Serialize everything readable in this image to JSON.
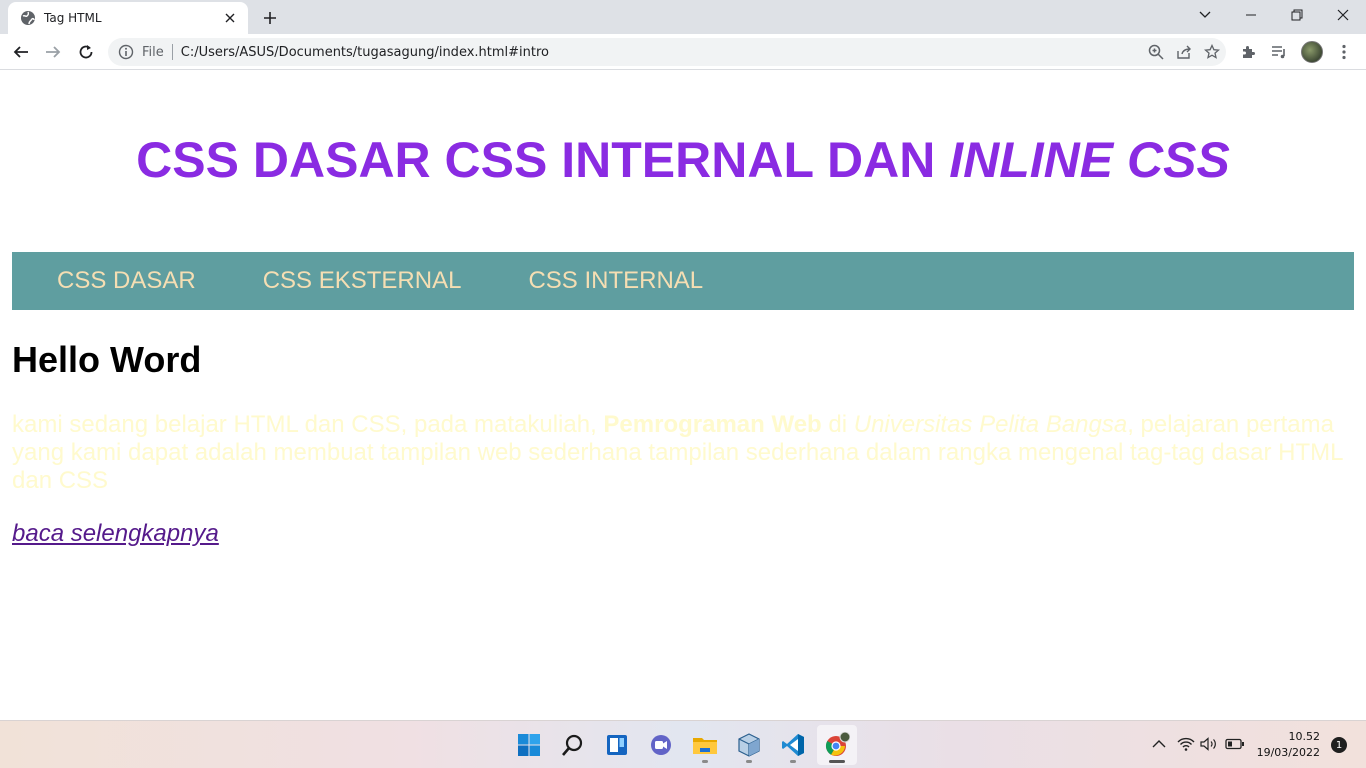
{
  "browser": {
    "tab_title": "Tag HTML",
    "omnibox_scheme_label": "File",
    "url": "C:/Users/ASUS/Documents/tugasagung/index.html#intro"
  },
  "page": {
    "heading_normal": "CSS DASAR CSS INTERNAL DAN ",
    "heading_italic": "INLINE CSS",
    "nav_items": [
      {
        "label": "CSS DASAR"
      },
      {
        "label": "CSS EKSTERNAL"
      },
      {
        "label": "CSS INTERNAL"
      }
    ],
    "content_heading": "Hello Word",
    "paragraph": {
      "part1": "kami sedang belajar HTML dan CSS, pada matakuliah, ",
      "bold": "Pemrograman Web",
      "part2": " di ",
      "italic": "Universitas Pelita Bangsa",
      "part3": ", pelajaran pertama yang kami dapat adalah membuat tampilan web sederhana tampilan sederhana dalam rangka mengenal tag-tag dasar HTML dan CSS"
    },
    "read_more": "baca selengkapnya"
  },
  "taskbar": {
    "apps": [
      "start-icon",
      "search-icon",
      "widgets-icon",
      "chat-icon",
      "file-explorer-icon",
      "package-icon",
      "vscode-icon",
      "chrome-icon"
    ],
    "time": "10.52",
    "date": "19/03/2022",
    "notification_count": "1"
  },
  "colors": {
    "heading": "#8a2be2",
    "navbar_bg": "#5f9ea0",
    "nav_text": "#f5deb3",
    "paragraph_text": "#fffacd",
    "link": "#551a8b"
  }
}
